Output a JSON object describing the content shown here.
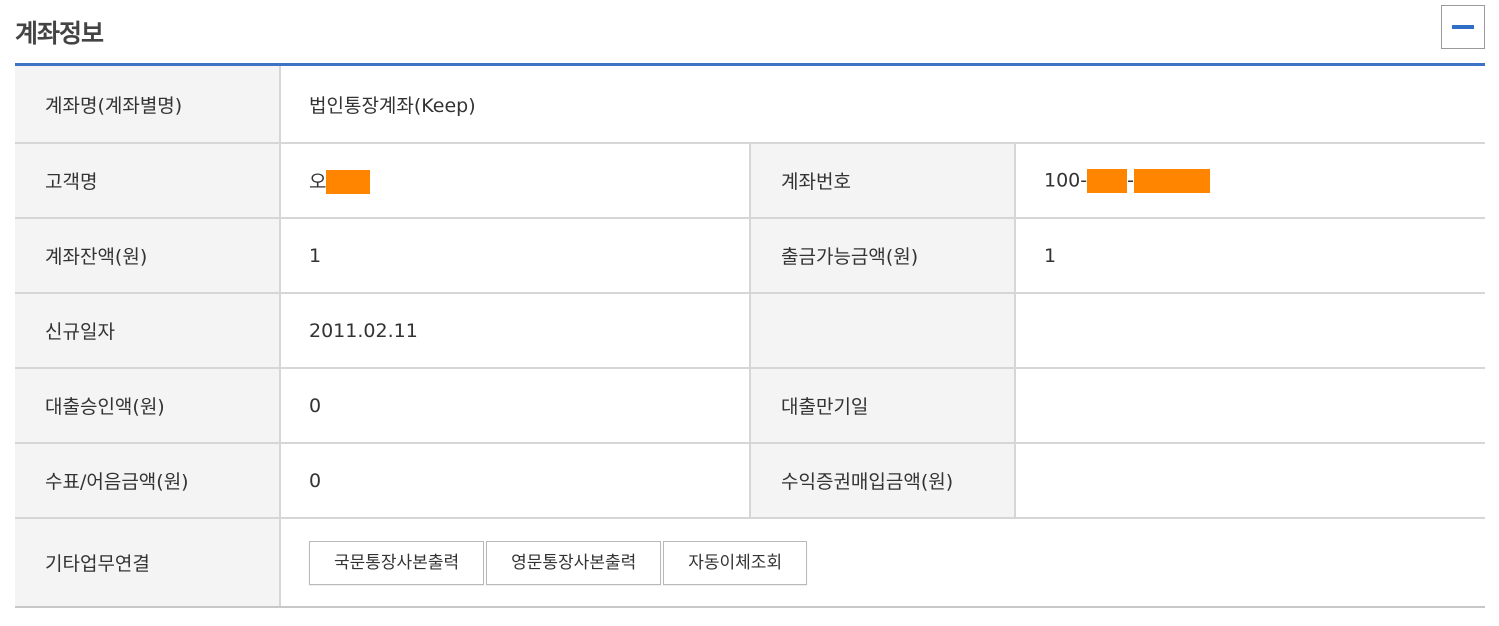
{
  "section": {
    "title": "계좌정보",
    "collapse_icon": "minus-icon"
  },
  "rows": {
    "account_name": {
      "label": "계좌명(계좌별명)",
      "value": "법인통장계좌(Keep)"
    },
    "customer": {
      "label": "고객명",
      "value_prefix": "오"
    },
    "account_number": {
      "label": "계좌번호",
      "value_prefix": "100-",
      "value_middle": "-"
    },
    "balance": {
      "label": "계좌잔액(원)",
      "value": "1"
    },
    "withdrawable": {
      "label": "출금가능금액(원)",
      "value": "1"
    },
    "open_date": {
      "label": "신규일자",
      "value": "2011.02.11"
    },
    "loan_approval": {
      "label": "대출승인액(원)",
      "value": "0"
    },
    "loan_maturity": {
      "label": "대출만기일",
      "value": ""
    },
    "check_bill": {
      "label": "수표/어음금액(원)",
      "value": "0"
    },
    "securities": {
      "label": "수익증권매입금액(원)",
      "value": ""
    },
    "other_links": {
      "label": "기타업무연결",
      "buttons": [
        "국문통장사본출력",
        "영문통장사본출력",
        "자동이체조회"
      ]
    }
  },
  "colors": {
    "accent": "#3d73c4",
    "mask": "#ff8400",
    "label_bg": "#f4f4f4"
  }
}
